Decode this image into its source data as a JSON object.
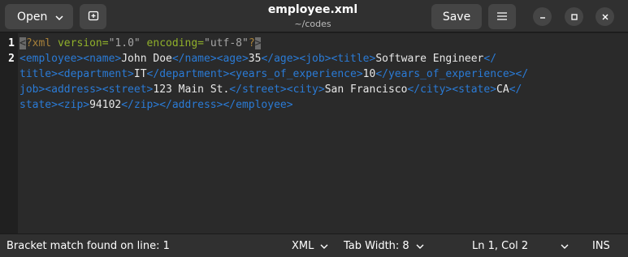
{
  "header": {
    "open_label": "Open",
    "title": "employee.xml",
    "subtitle": "~/codes",
    "save_label": "Save"
  },
  "editor": {
    "line_numbers": [
      "1",
      "2"
    ],
    "line1": {
      "decl_open": "<?xml ",
      "attr1": "version=",
      "val1": "\"1.0\"",
      "attr2": " encoding=",
      "val2": "\"utf-8\"",
      "decl_close": "?>"
    },
    "line2": [
      {
        "kind": "tag",
        "text": "<employee><name>"
      },
      {
        "kind": "txt",
        "text": "John Doe"
      },
      {
        "kind": "tag",
        "text": "</name><age>"
      },
      {
        "kind": "txt",
        "text": "35"
      },
      {
        "kind": "tag",
        "text": "</age><job><title>"
      },
      {
        "kind": "txt",
        "text": "Software Engineer"
      },
      {
        "kind": "tag",
        "text": "</"
      },
      {
        "kind": "br"
      },
      {
        "kind": "tag",
        "text": "title><department>"
      },
      {
        "kind": "txt",
        "text": "IT"
      },
      {
        "kind": "tag",
        "text": "</department><years_of_experience>"
      },
      {
        "kind": "txt",
        "text": "10"
      },
      {
        "kind": "tag",
        "text": "</years_of_experience></"
      },
      {
        "kind": "br"
      },
      {
        "kind": "tag",
        "text": "job><address><street>"
      },
      {
        "kind": "txt",
        "text": "123 Main St."
      },
      {
        "kind": "tag",
        "text": "</street><city>"
      },
      {
        "kind": "txt",
        "text": "San Francisco"
      },
      {
        "kind": "tag",
        "text": "</city><state>"
      },
      {
        "kind": "txt",
        "text": "CA"
      },
      {
        "kind": "tag",
        "text": "</"
      },
      {
        "kind": "br"
      },
      {
        "kind": "tag",
        "text": "state><zip>"
      },
      {
        "kind": "txt",
        "text": "94102"
      },
      {
        "kind": "tag",
        "text": "</zip></address></employee>"
      }
    ]
  },
  "status": {
    "bracket_match": "Bracket match found on line: 1",
    "language": "XML",
    "tab_width": "Tab Width: 8",
    "position": "Ln 1, Col 2",
    "mode": "INS"
  },
  "icons": {
    "open_chevron": "chevron-down-icon",
    "new_tab": "new-tab-icon",
    "menu": "hamburger-menu-icon",
    "minimize": "minimize-icon",
    "maximize": "maximize-icon",
    "close": "close-icon"
  }
}
